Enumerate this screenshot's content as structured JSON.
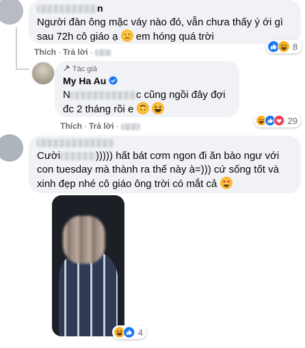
{
  "comment1": {
    "author_suffix": "n",
    "text": "Người đàn ông mặc váy nào đó, vẫn chưa thấy ý ới gì sau 72h cô giáo ạ",
    "text_tail": "em hóng quá trời",
    "like_label": "Thích",
    "reply_label": "Trả lời",
    "reaction_count": "8"
  },
  "reply": {
    "badge": "Tác giả",
    "author": "My Ha Au",
    "text_start": "N",
    "text_rest": "c cũng ngồi đây đợi đc 2 tháng rồi e",
    "like_label": "Thích",
    "reply_label": "Trả lời",
    "reaction_count": "29"
  },
  "comment2": {
    "text_start": "Cười",
    "text_after_blur": ")))))",
    "text_rest": "hất bát cơm ngon đi ăn bào ngư với con tuesday mà thành ra thế này à=))) cứ sống tốt và xinh đẹp nhé cô giáo ông trời có mắt cả",
    "reaction_count": "4"
  },
  "colors": {
    "bubble": "#f0f2f5",
    "secondary_text": "#65676b",
    "like_blue": "#1877f2",
    "heart_red": "#f33e58",
    "haha_yellow": "#f7b125"
  }
}
